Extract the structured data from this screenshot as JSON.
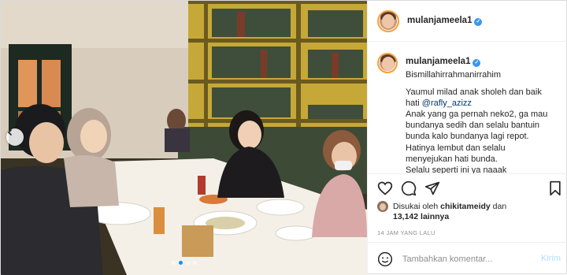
{
  "post": {
    "author": {
      "username": "mulanjameela1",
      "verified": true
    },
    "caption": {
      "lines": [
        "Bismillahirrahmanirrahim",
        "",
        "Yaumul milad anak sholeh dan baik",
        "hati ",
        "Anak yang ga pernah neko2, ga mau",
        "bundanya sedih dan selalu bantuin",
        "bunda kalo bundanya lagi repot.",
        "Hatinya lembut dan selalu",
        "menyejukan hati bunda.",
        "Selalu seperti ini ya naaak"
      ],
      "mention": "@rafly_azizz"
    },
    "likes": {
      "prefix": "Disukai oleh ",
      "liker": "chikitameidy",
      "joiner": " dan",
      "count": "13,142",
      "suffix": " lainnya"
    },
    "timestamp": "14 JAM YANG LALU",
    "comment_box": {
      "placeholder": "Tambahkan komentar...",
      "post_label": "Kirim"
    },
    "carousel": {
      "total": 4,
      "active_index": 0
    }
  },
  "icons": {
    "like": "heart-icon",
    "comment": "comment-bubble-icon",
    "share": "paper-plane-icon",
    "save": "bookmark-icon",
    "emoji": "smiley-icon",
    "prev": "chevron-left-icon",
    "verified": "verified-badge-icon"
  },
  "colors": {
    "link": "#00376b",
    "verified": "#3897f0",
    "post_button": "#b2dffc",
    "muted": "#8e8e8e"
  }
}
